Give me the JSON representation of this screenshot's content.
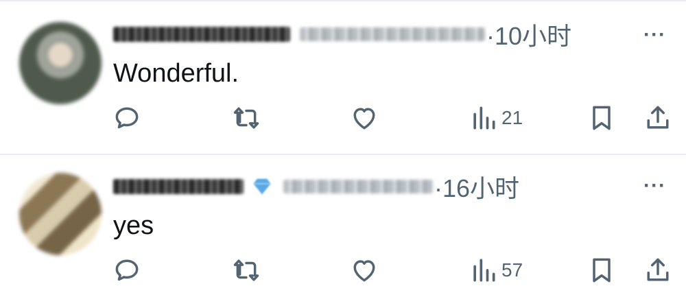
{
  "replies": [
    {
      "text": "Wonderful.",
      "time": "·10小时",
      "more": "···",
      "views": "21",
      "avatar_colors": [
        "#3e4a3c",
        "#c9ccc8",
        "#7f8b7b"
      ],
      "verified": false
    },
    {
      "text": "yes",
      "time": "·16小时",
      "more": "···",
      "views": "57",
      "avatar_colors": [
        "#7f6d4e",
        "#e8dcc0",
        "#a68f65"
      ],
      "verified": true,
      "verified_color": "#5aa9e6"
    }
  ],
  "icons": {
    "reply": "reply-icon",
    "retweet": "retweet-icon",
    "like": "heart-icon",
    "views": "views-bar-icon",
    "bookmark": "bookmark-icon",
    "share": "share-icon",
    "more": "more-icon"
  },
  "colors": {
    "icon": "#536471",
    "text": "#0f1419",
    "divider": "#e8ecef"
  }
}
